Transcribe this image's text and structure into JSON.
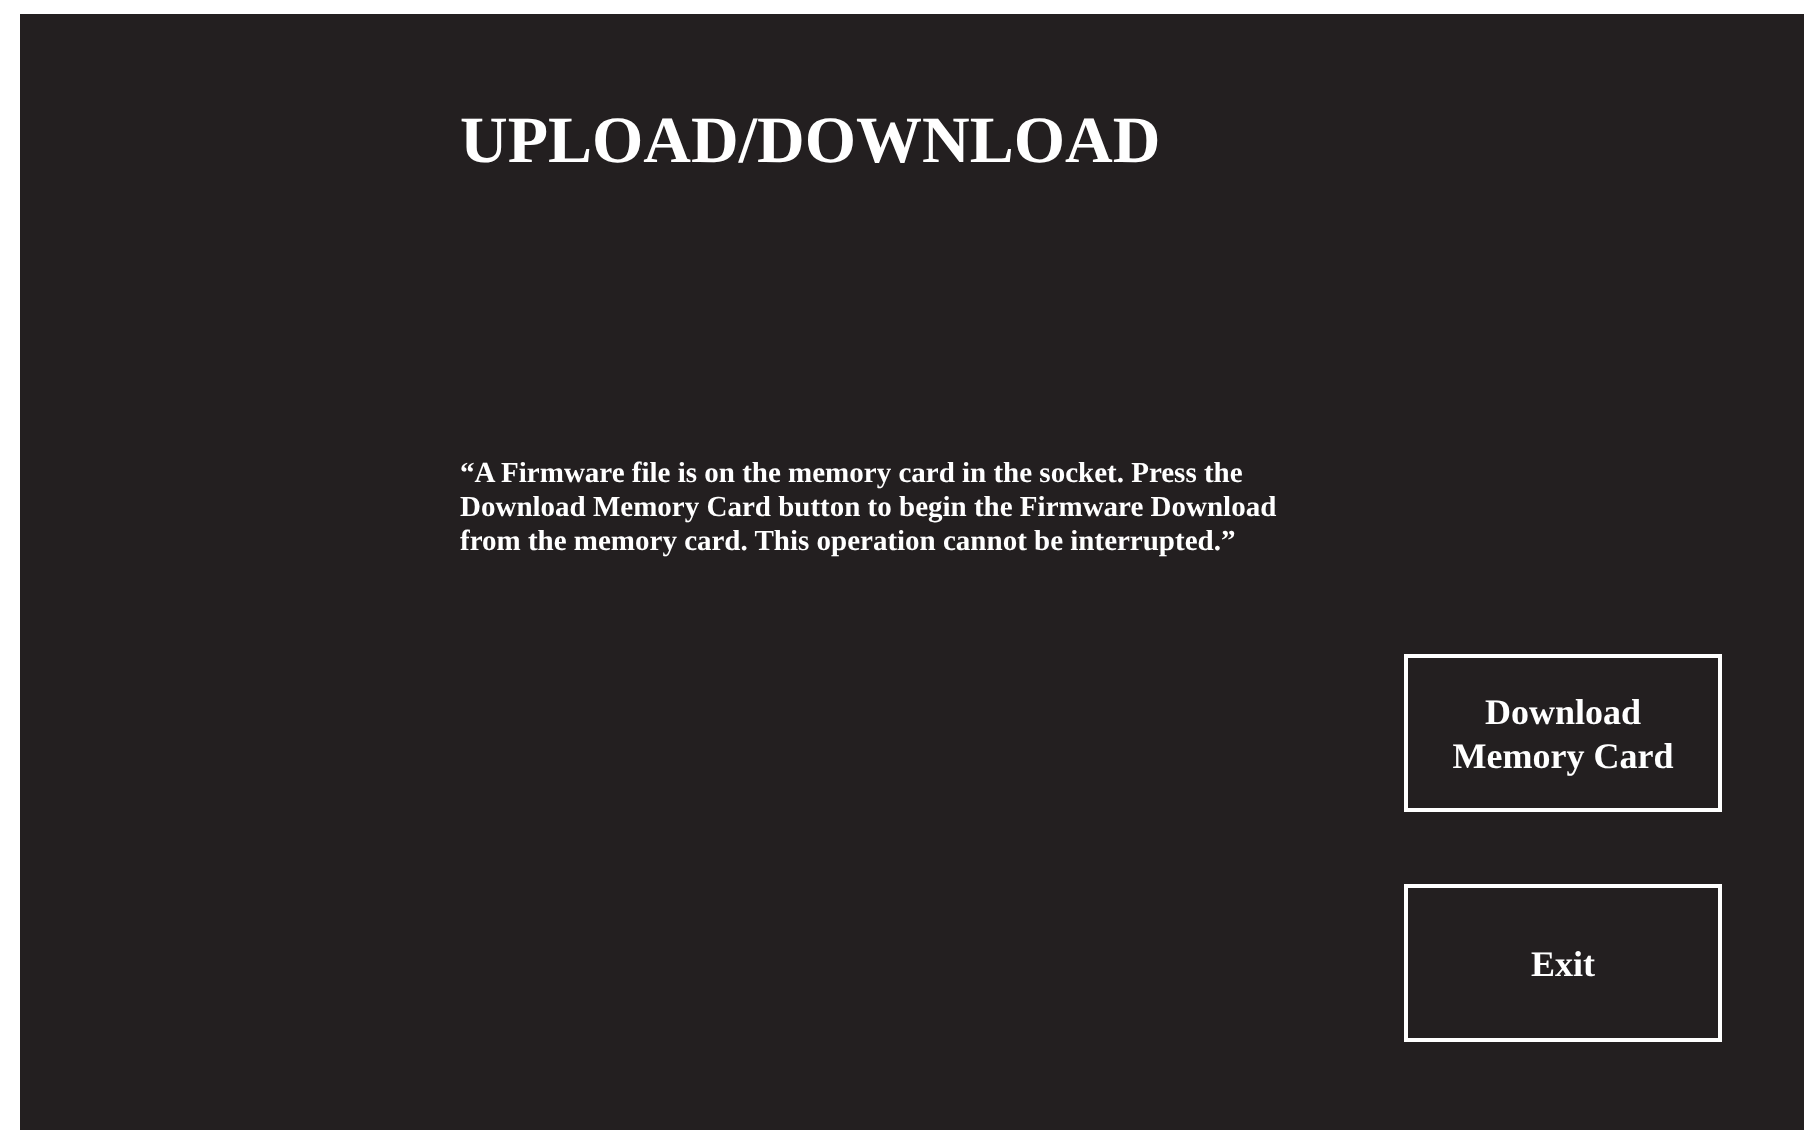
{
  "title": "UPLOAD/DOWNLOAD",
  "message": "“A Firmware file is on the memory card in the socket. Press the Download Memory Card button to begin the Firmware Download from the memory card. This operation cannot be interrupted.”",
  "buttons": [
    {
      "label": "Download Memory Card"
    },
    {
      "label": "Exit"
    }
  ]
}
